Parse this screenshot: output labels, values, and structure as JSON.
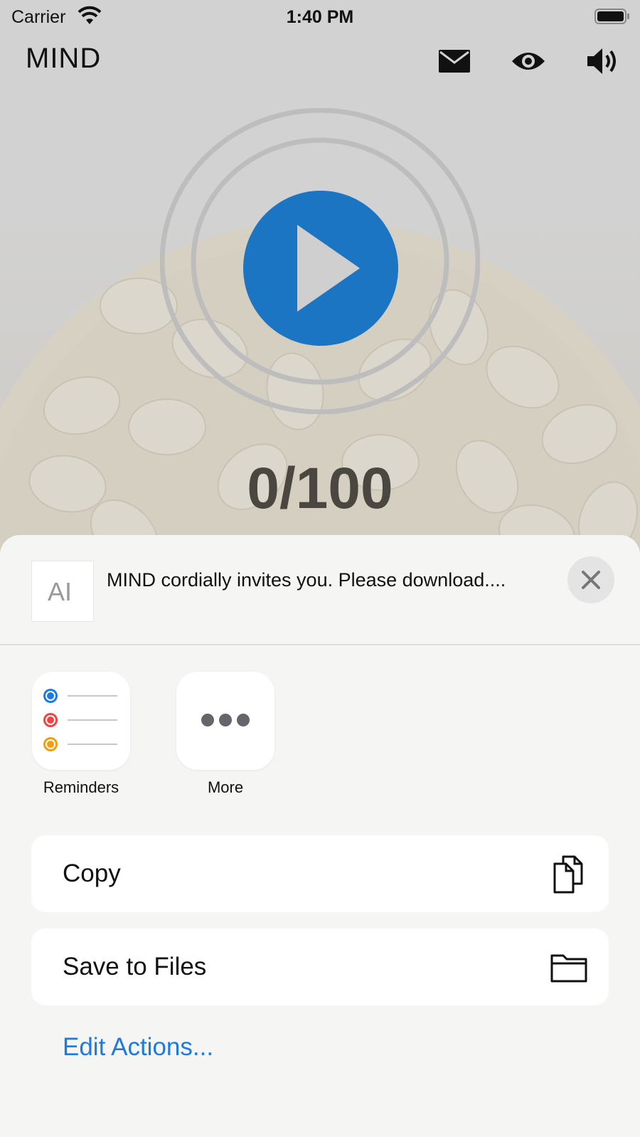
{
  "status_bar": {
    "carrier": "Carrier",
    "time": "1:40 PM"
  },
  "header": {
    "title": "MIND",
    "icons": [
      "mail-icon",
      "eye-icon",
      "speaker-icon"
    ]
  },
  "player": {
    "counter": "0/100",
    "accent": "#1c75c2"
  },
  "share_sheet": {
    "preview_icon_text": "AI",
    "preview_text": "MIND cordially invites you. Please download....",
    "apps": [
      {
        "label": "Reminders",
        "icon": "reminders-icon"
      },
      {
        "label": "More",
        "icon": "more-icon"
      }
    ],
    "actions": [
      {
        "label": "Copy",
        "icon": "copy-icon"
      },
      {
        "label": "Save to Files",
        "icon": "folder-icon"
      }
    ],
    "edit_actions": "Edit Actions...",
    "link_color": "#1c7ae0"
  }
}
